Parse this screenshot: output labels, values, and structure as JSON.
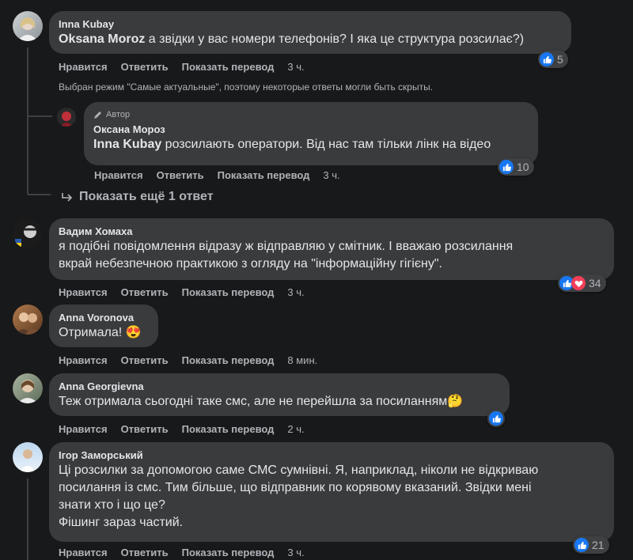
{
  "actions": {
    "like": "Нравится",
    "reply": "Ответить",
    "translate": "Показать перевод"
  },
  "comments": [
    {
      "author": "Inna Kubay",
      "mention": "Oksana Moroz",
      "text": " а звідки у вас номери телефонів? І яка це структура розсилає?)",
      "time": "3 ч.",
      "reactions": "5"
    },
    {
      "author": "Оксана Мороз",
      "badge": "Автор",
      "mention": "Inna Kubay",
      "text": " розсилають оператори. Від нас там тільки лінк на відео",
      "time": "3 ч.",
      "reactions": "10"
    },
    {
      "author": "Вадим Хомаха",
      "line1": "я подібні повідомлення відразу ж відправляю у смітник. І вважаю розсилання",
      "line2": "вкрай небезпечною практикою з огляду на \"інформаційну гігієну\".",
      "time": "3 ч.",
      "reactions": "34"
    },
    {
      "author": "Anna Voronova",
      "text": "Отримала! 😍",
      "time": "8 мин."
    },
    {
      "author": "Anna Georgievna",
      "text": "Теж отримала сьогодні таке смс, але не перейшла за посиланням🤔",
      "time": "2 ч."
    },
    {
      "author": "Ігор Заморський",
      "line1": "Ці розсилки за допомогою саме СМС сумнівні. Я, наприклад, ніколи не відкриваю",
      "line2": "посилання із смс. Тим більше, що відправник по корявому вказаний. Звідки мені",
      "line3": "знати хто і що це?",
      "line4": "Фішинг зараз частий.",
      "time": "3 ч.",
      "reactions": "21"
    }
  ],
  "note": "Выбран режим \"Самые актуальные\", поэтому некоторые ответы могли быть скрыты.",
  "show_more": "Показать ещё 1 ответ",
  "colors": {
    "background": "#18191a",
    "bubble": "#3a3b3c",
    "like": "#1877f2",
    "love": "#f33e58"
  }
}
